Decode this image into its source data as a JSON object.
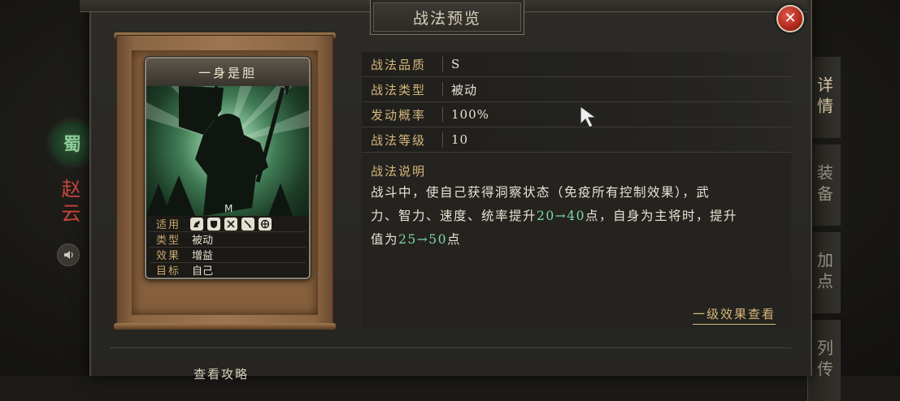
{
  "dialog": {
    "title": "战法预览",
    "close_label": "✕"
  },
  "hero": {
    "faction": "蜀",
    "name": "赵云"
  },
  "right_tabs": [
    {
      "label": "详情",
      "active": true
    },
    {
      "label": "装备",
      "active": false
    },
    {
      "label": "加点",
      "active": false
    },
    {
      "label": "列传",
      "active": false
    }
  ],
  "skill_card": {
    "name": "一身是胆",
    "rows": [
      {
        "key": "适用",
        "value": ""
      },
      {
        "key": "类型",
        "value": "被动"
      },
      {
        "key": "效果",
        "value": "增益"
      },
      {
        "key": "目标",
        "value": "自己"
      }
    ],
    "apply_icons": [
      "cavalry-icon",
      "shield-icon",
      "bow-icon",
      "spear-icon",
      "siege-icon"
    ]
  },
  "info": {
    "rows": [
      {
        "key": "战法品质",
        "value": "S"
      },
      {
        "key": "战法类型",
        "value": "被动"
      },
      {
        "key": "发动概率",
        "value": "100%"
      },
      {
        "key": "战法等级",
        "value": "10"
      }
    ],
    "description_title": "战法说明",
    "description": {
      "p1": "战斗中，使自己获得洞察状态（免疫所有控制效果），武",
      "p2a": "力、智力、速度、统率提升",
      "hl1": "20→40",
      "p2b": "点，自身为主将时，提升",
      "p3a": "值为",
      "hl2": "25→50",
      "p3b": "点"
    },
    "level_link": "一级效果查看"
  },
  "bottom": {
    "guide_label": "查看攻略"
  },
  "colors": {
    "accent_gold": "#d6b77c",
    "highlight_green": "#7fd6a8",
    "close_red": "#b0281d"
  }
}
